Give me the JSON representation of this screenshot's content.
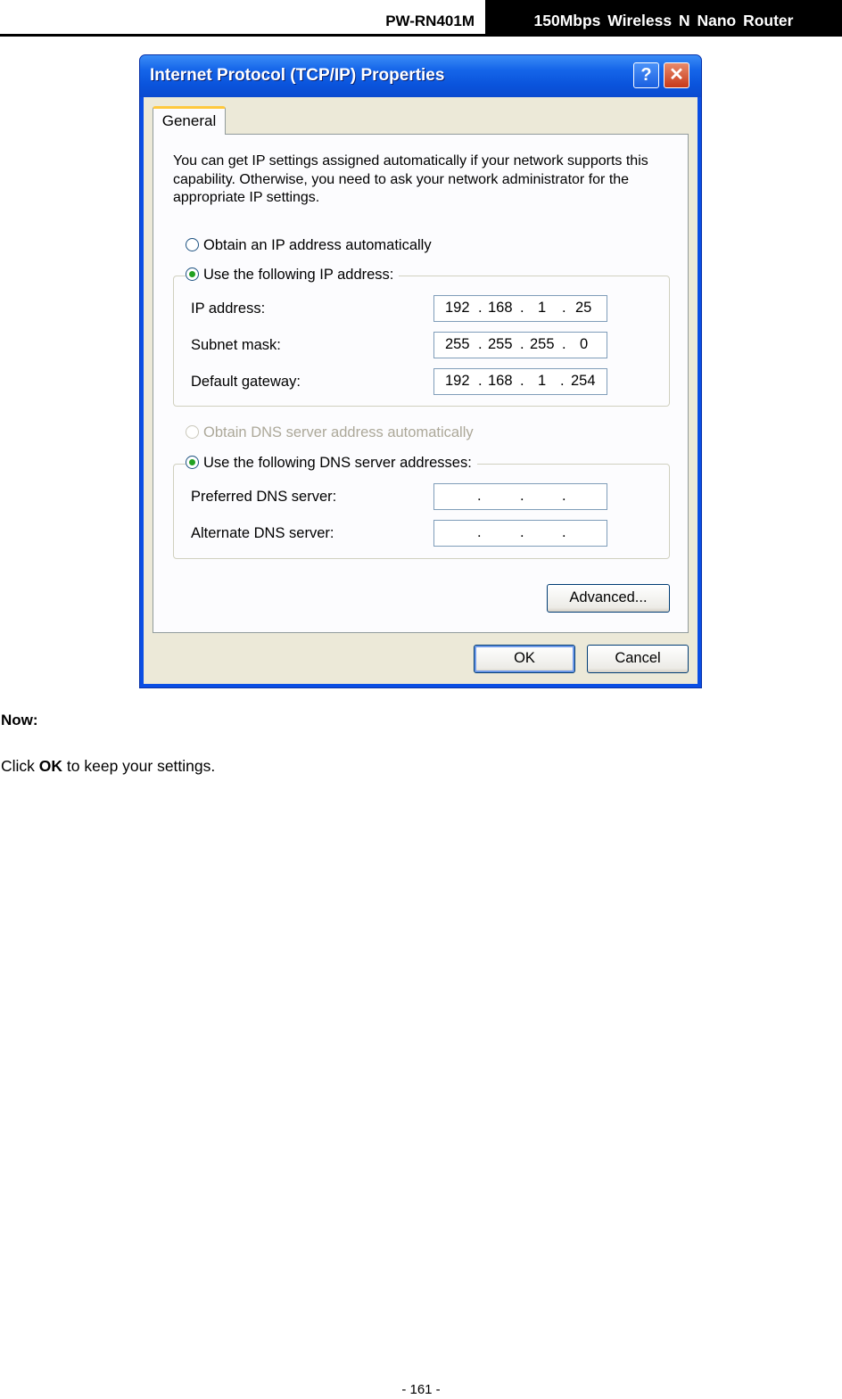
{
  "header": {
    "model": "PW-RN401M",
    "title": "150Mbps Wireless N Nano Router"
  },
  "dialog": {
    "title": "Internet Protocol (TCP/IP) Properties",
    "help_glyph": "?",
    "close_glyph": "✕",
    "tab": "General",
    "intro": "You can get IP settings assigned automatically if your network supports this capability. Otherwise, you need to ask your network administrator for the appropriate IP settings.",
    "ip_auto_label": "Obtain an IP address automatically",
    "ip_manual_label": "Use the following IP address:",
    "ip_mode": "manual",
    "fields": {
      "ip": {
        "label": "IP address:",
        "octets": [
          "192",
          "168",
          "1",
          "25"
        ]
      },
      "mask": {
        "label": "Subnet mask:",
        "octets": [
          "255",
          "255",
          "255",
          "0"
        ]
      },
      "gateway": {
        "label": "Default gateway:",
        "octets": [
          "192",
          "168",
          "1",
          "254"
        ]
      }
    },
    "dns_auto_label": "Obtain DNS server address automatically",
    "dns_manual_label": "Use the following DNS server addresses:",
    "dns_mode": "manual",
    "dns": {
      "preferred": {
        "label": "Preferred DNS server:",
        "octets": [
          "",
          "",
          "",
          ""
        ]
      },
      "alternate": {
        "label": "Alternate DNS server:",
        "octets": [
          "",
          "",
          "",
          ""
        ]
      }
    },
    "advanced_label": "Advanced...",
    "ok_label": "OK",
    "cancel_label": "Cancel"
  },
  "body": {
    "now_heading": "Now:",
    "instruction_prefix": "Click ",
    "instruction_bold": "OK",
    "instruction_suffix": " to keep your settings."
  },
  "footer": {
    "page_number": "- 161 -"
  },
  "colors": {
    "title_bar": "#0a54dc",
    "dialog_bg": "#ece9d8",
    "radio_dot": "#21a121",
    "tab_highlight": "#ffc83c"
  }
}
